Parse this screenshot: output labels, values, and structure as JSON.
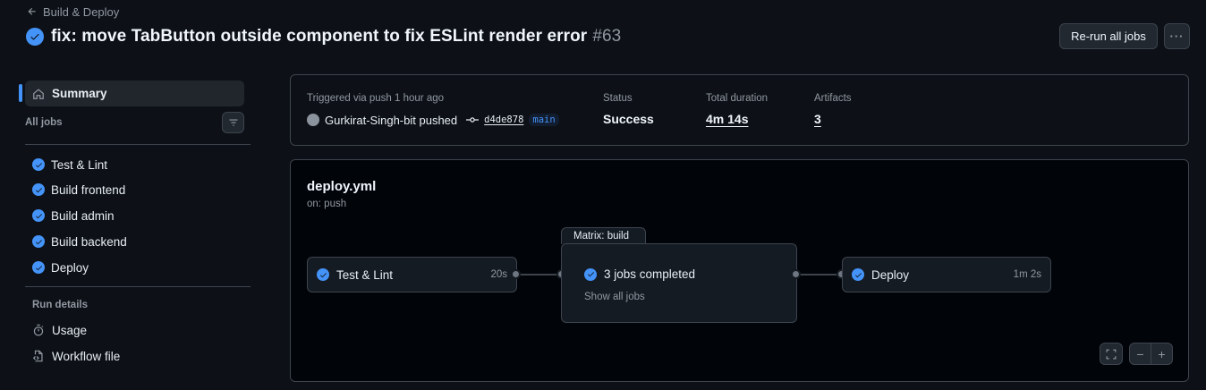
{
  "header": {
    "back_label": "Build & Deploy",
    "title": "fix: move TabButton outside component to fix ESLint render error",
    "run_number": "#63",
    "rerun_label": "Re-run all jobs",
    "more_label": "···"
  },
  "sidebar": {
    "summary_label": "Summary",
    "all_jobs_label": "All jobs",
    "jobs": [
      {
        "label": "Test & Lint"
      },
      {
        "label": "Build frontend"
      },
      {
        "label": "Build admin"
      },
      {
        "label": "Build backend"
      },
      {
        "label": "Deploy"
      }
    ],
    "run_details_label": "Run details",
    "usage_label": "Usage",
    "workflow_file_label": "Workflow file"
  },
  "summary": {
    "trigger_label": "Triggered via push 1 hour ago",
    "actor": "Gurkirat-Singh-bit pushed",
    "commit": "d4de878",
    "branch": "main",
    "status_label": "Status",
    "status_value": "Success",
    "duration_label": "Total duration",
    "duration_value": "4m 14s",
    "artifacts_label": "Artifacts",
    "artifacts_value": "3"
  },
  "graph": {
    "workflow_name": "deploy.yml",
    "trigger": "on: push",
    "nodes": {
      "test_lint": {
        "label": "Test & Lint",
        "duration": "20s"
      },
      "matrix": {
        "tab_label": "Matrix: build",
        "label": "3 jobs completed",
        "link": "Show all jobs"
      },
      "deploy": {
        "label": "Deploy",
        "duration": "1m 2s"
      }
    },
    "zoom_out": "−",
    "zoom_in": "+"
  },
  "colors": {
    "accent": "#4493f8",
    "background": "#0d1117",
    "graph_background": "#010409",
    "border": "#3d444d"
  }
}
